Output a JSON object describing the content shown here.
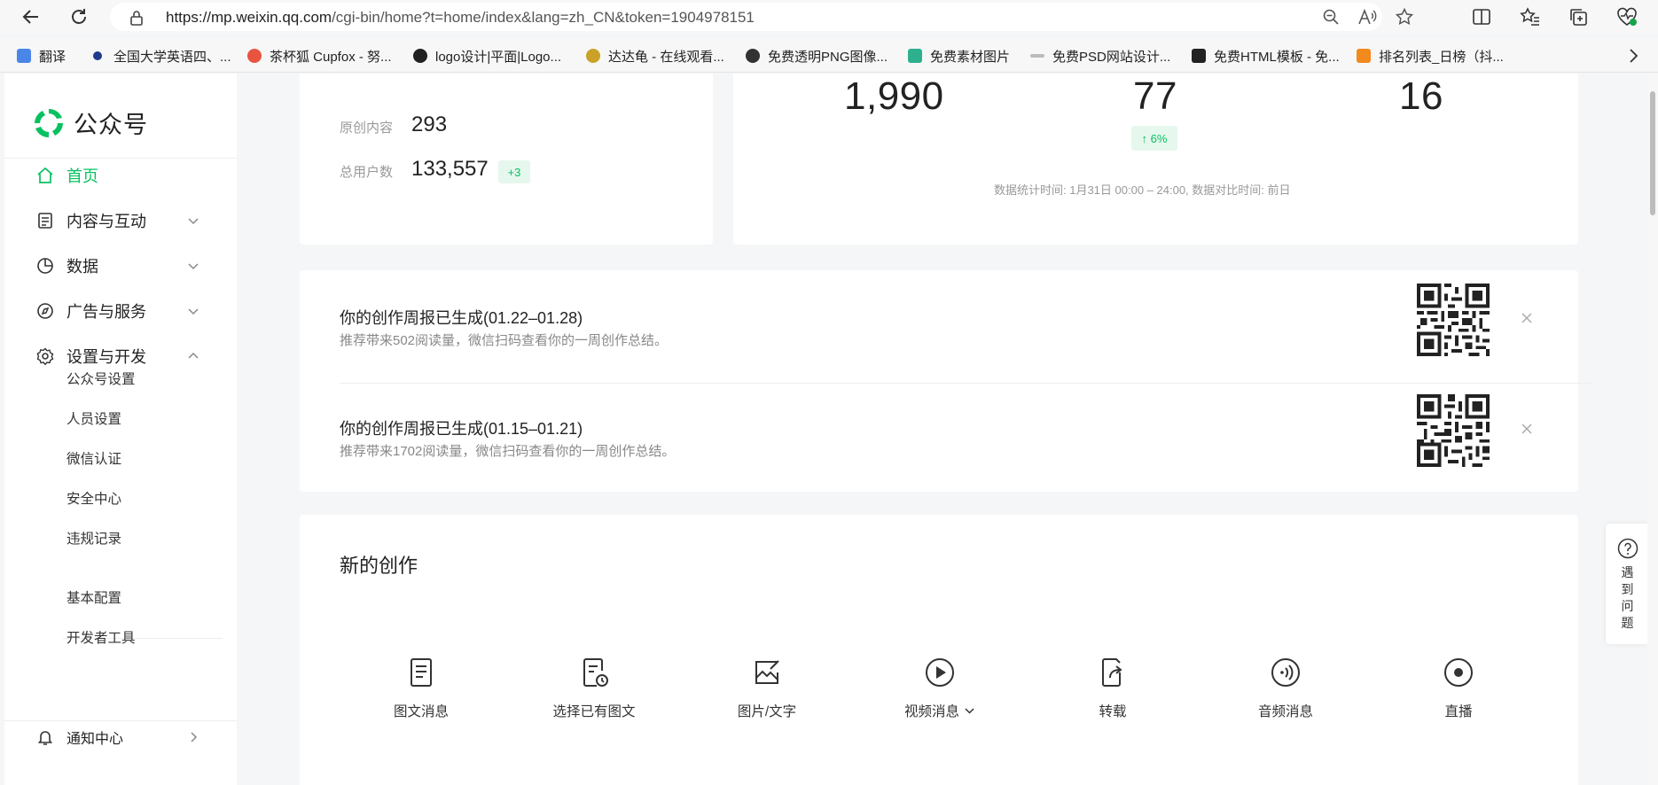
{
  "browser": {
    "url_host": "https://mp.weixin.qq.com",
    "url_path": "/cgi-bin/home?t=home/index&lang=zh_CN&token=1904978151",
    "bookmarks": [
      {
        "label": "翻译",
        "color": "#4a86e8"
      },
      {
        "label": "全国大学英语四、...",
        "color": "#1f3b8c"
      },
      {
        "label": "茶杯狐 Cupfox - 努...",
        "color": "#e8543f"
      },
      {
        "label": "logo设计|平面|Logo...",
        "color": "#222222"
      },
      {
        "label": "达达龟 - 在线观看...",
        "color": "#c9a227"
      },
      {
        "label": "免费透明PNG图像...",
        "color": "#333333"
      },
      {
        "label": "免费素材图片",
        "color": "#2eb08e"
      },
      {
        "label": "免费PSD网站设计...",
        "color": "#999999"
      },
      {
        "label": "免费HTML模板 - 免...",
        "color": "#222222"
      },
      {
        "label": "排名列表_日榜（抖...",
        "color": "#f28a1e"
      }
    ]
  },
  "sidebar": {
    "logo_text": "公众号",
    "nav": [
      {
        "label": "首页",
        "icon": "home-icon",
        "active": true
      },
      {
        "label": "内容与互动",
        "icon": "document-icon"
      },
      {
        "label": "数据",
        "icon": "pie-chart-icon"
      },
      {
        "label": "广告与服务",
        "icon": "compass-icon"
      },
      {
        "label": "设置与开发",
        "icon": "gear-icon"
      }
    ],
    "sub_items": [
      "公众号设置",
      "人员设置",
      "微信认证",
      "安全中心",
      "违规记录"
    ],
    "sub_items2": [
      "基本配置",
      "开发者工具"
    ],
    "notification": "通知中心"
  },
  "account_stats": {
    "original_label": "原创内容",
    "original_value": "293",
    "users_label": "总用户数",
    "users_value": "133,557",
    "users_delta": "+3"
  },
  "daily_stats": {
    "values": [
      "1,990",
      "77",
      "16"
    ],
    "change": "↑ 6%",
    "footnote": "数据统计时间: 1月31日 00:00 – 24:00, 数据对比时间: 前日"
  },
  "reports": [
    {
      "title": "你的创作周报已生成(01.22–01.28)",
      "desc": "推荐带来502阅读量，微信扫码查看你的一周创作总结。"
    },
    {
      "title": "你的创作周报已生成(01.15–01.21)",
      "desc": "推荐带来1702阅读量，微信扫码查看你的一周创作总结。"
    }
  ],
  "creation": {
    "title": "新的创作",
    "items": [
      {
        "label": "图文消息",
        "icon": "article-icon"
      },
      {
        "label": "选择已有图文",
        "icon": "history-article-icon"
      },
      {
        "label": "图片/文字",
        "icon": "image-icon"
      },
      {
        "label": "视频消息",
        "icon": "video-icon"
      },
      {
        "label": "转载",
        "icon": "repost-icon"
      },
      {
        "label": "音频消息",
        "icon": "audio-icon"
      },
      {
        "label": "直播",
        "icon": "live-icon"
      }
    ]
  },
  "help": {
    "label": "遇到问题"
  },
  "colors": {
    "accent": "#07c160",
    "page_bg": "#f5f6f7"
  }
}
